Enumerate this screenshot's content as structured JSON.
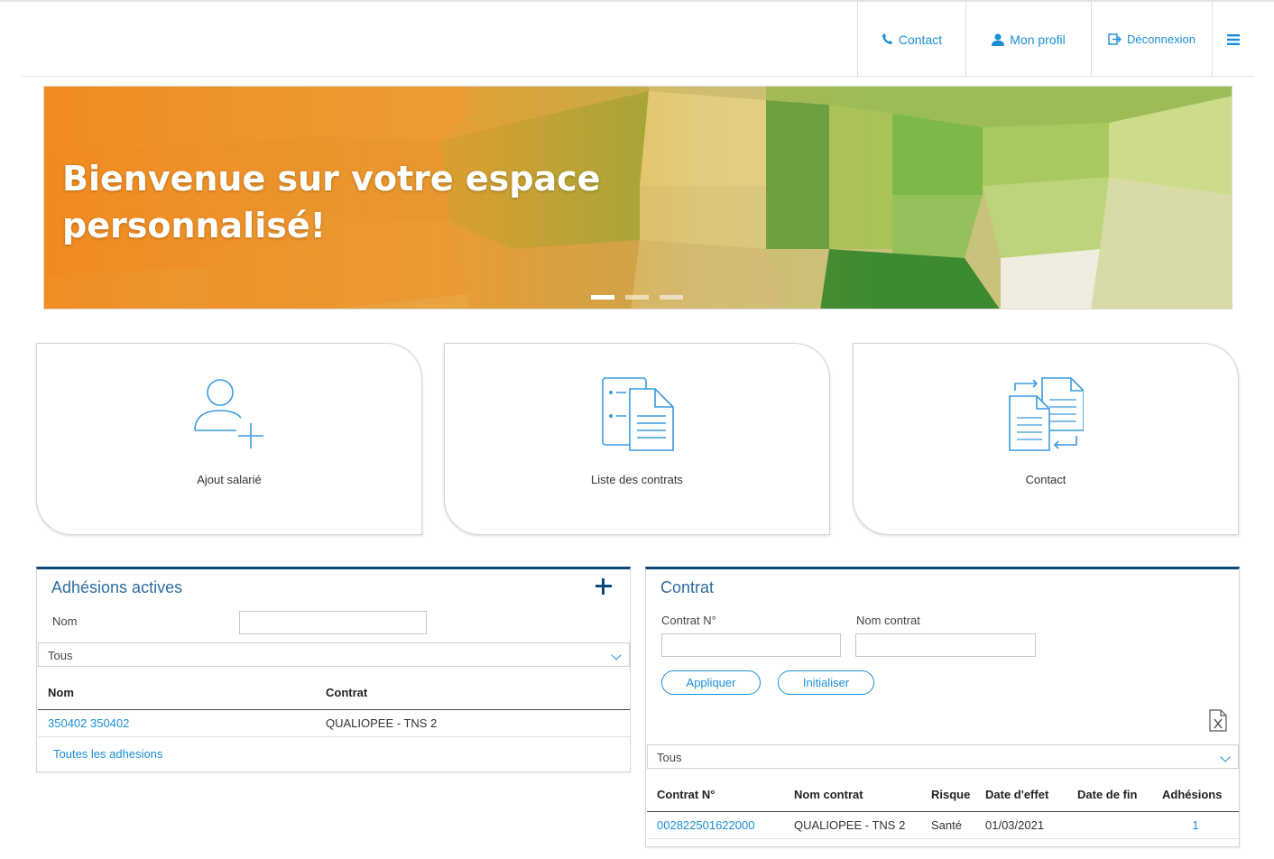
{
  "header": {
    "nav": {
      "contact": "Contact",
      "profile": "Mon profil",
      "logout": "Déconnexion"
    }
  },
  "banner": {
    "title": "Bienvenue sur votre espace personnalisé!",
    "slides": 3,
    "active_slide": 1
  },
  "tiles": [
    {
      "label": "Ajout salarié",
      "icon": "add-user-icon"
    },
    {
      "label": "Liste des contrats",
      "icon": "contract-list-icon"
    },
    {
      "label": "Contact",
      "icon": "document-exchange-icon"
    }
  ],
  "adhesions": {
    "title": "Adhésions actives",
    "name_label": "Nom",
    "name_value": "",
    "filter_selected": "Tous",
    "columns": [
      "Nom",
      "Contrat"
    ],
    "rows": [
      {
        "nom": "350402 350402",
        "contrat": "QUALIOPEE - TNS 2"
      }
    ],
    "all_link": "Toutes les adhesions"
  },
  "contrat": {
    "title": "Contrat",
    "contract_no_label": "Contrat N°",
    "contract_name_label": "Nom contrat",
    "contract_no_value": "",
    "contract_name_value": "",
    "apply_button": "Appliquer",
    "reset_button": "Initialiser",
    "filter_selected": "Tous",
    "columns": [
      "Contrat N°",
      "Nom contrat",
      "Risque",
      "Date d'effet",
      "Date de fin",
      "Adhésions"
    ],
    "rows": [
      {
        "no": "002822501622000",
        "nom": "QUALIOPEE - TNS 2",
        "risque": "Santé",
        "effet": "01/03/2021",
        "fin": "",
        "adhesions": "1"
      }
    ]
  },
  "colors": {
    "accent": "#1a8fd6",
    "panel_border": "#0a4a7a",
    "title_blue": "#2f6da0"
  }
}
